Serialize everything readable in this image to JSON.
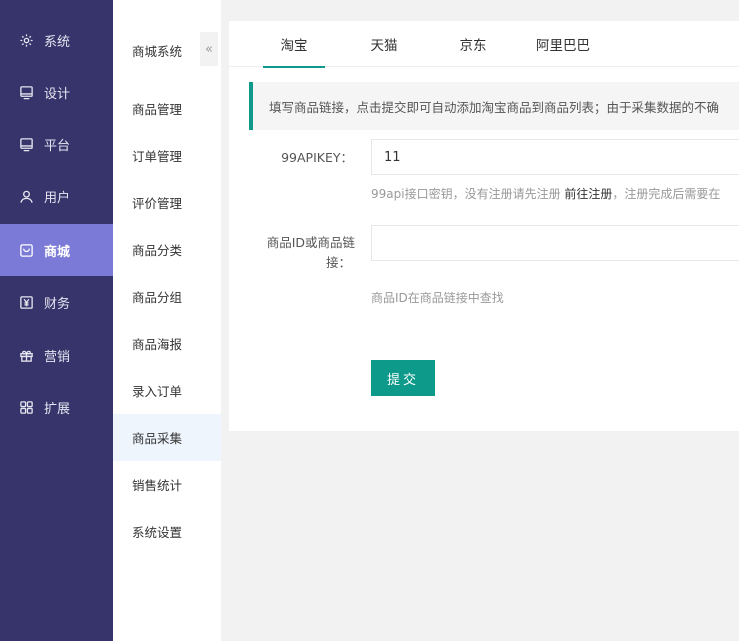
{
  "primary_nav": {
    "items": [
      {
        "label": "系统",
        "icon": "gear-icon"
      },
      {
        "label": "设计",
        "icon": "monitor-icon"
      },
      {
        "label": "平台",
        "icon": "monitor-icon"
      },
      {
        "label": "用户",
        "icon": "user-icon"
      },
      {
        "label": "商城",
        "icon": "shop-icon"
      },
      {
        "label": "财务",
        "icon": "yen-icon"
      },
      {
        "label": "营销",
        "icon": "gift-icon"
      },
      {
        "label": "扩展",
        "icon": "grid-icon"
      }
    ],
    "active_index": 4,
    "active_color": "#7b7ad6",
    "background": "#37336b"
  },
  "secondary_nav": {
    "title": "商城系统",
    "collapse_label": "«",
    "items": [
      "商品管理",
      "订单管理",
      "评价管理",
      "商品分类",
      "商品分组",
      "商品海报",
      "录入订单",
      "商品采集",
      "销售统计",
      "系统设置"
    ],
    "active_index": 7
  },
  "tabs": [
    "淘宝",
    "天猫",
    "京东",
    "阿里巴巴"
  ],
  "active_tab": 0,
  "accent_color": "#0d9a8a",
  "notice": "填写商品链接，点击提交即可自动添加淘宝商品到商品列表；由于采集数据的不确",
  "form": {
    "apikey_label": "99APIKEY：",
    "apikey_value": "11",
    "apikey_help_prefix": "99api接口密钥，没有注册请先注册",
    "apikey_help_link": "前往注册",
    "apikey_help_suffix": "，注册完成后需要在",
    "goods_label_line1": "商品ID或商品链",
    "goods_label_line2": "接：",
    "goods_value": "",
    "goods_help": "商品ID在商品链接中查找",
    "submit_label": "提交"
  }
}
